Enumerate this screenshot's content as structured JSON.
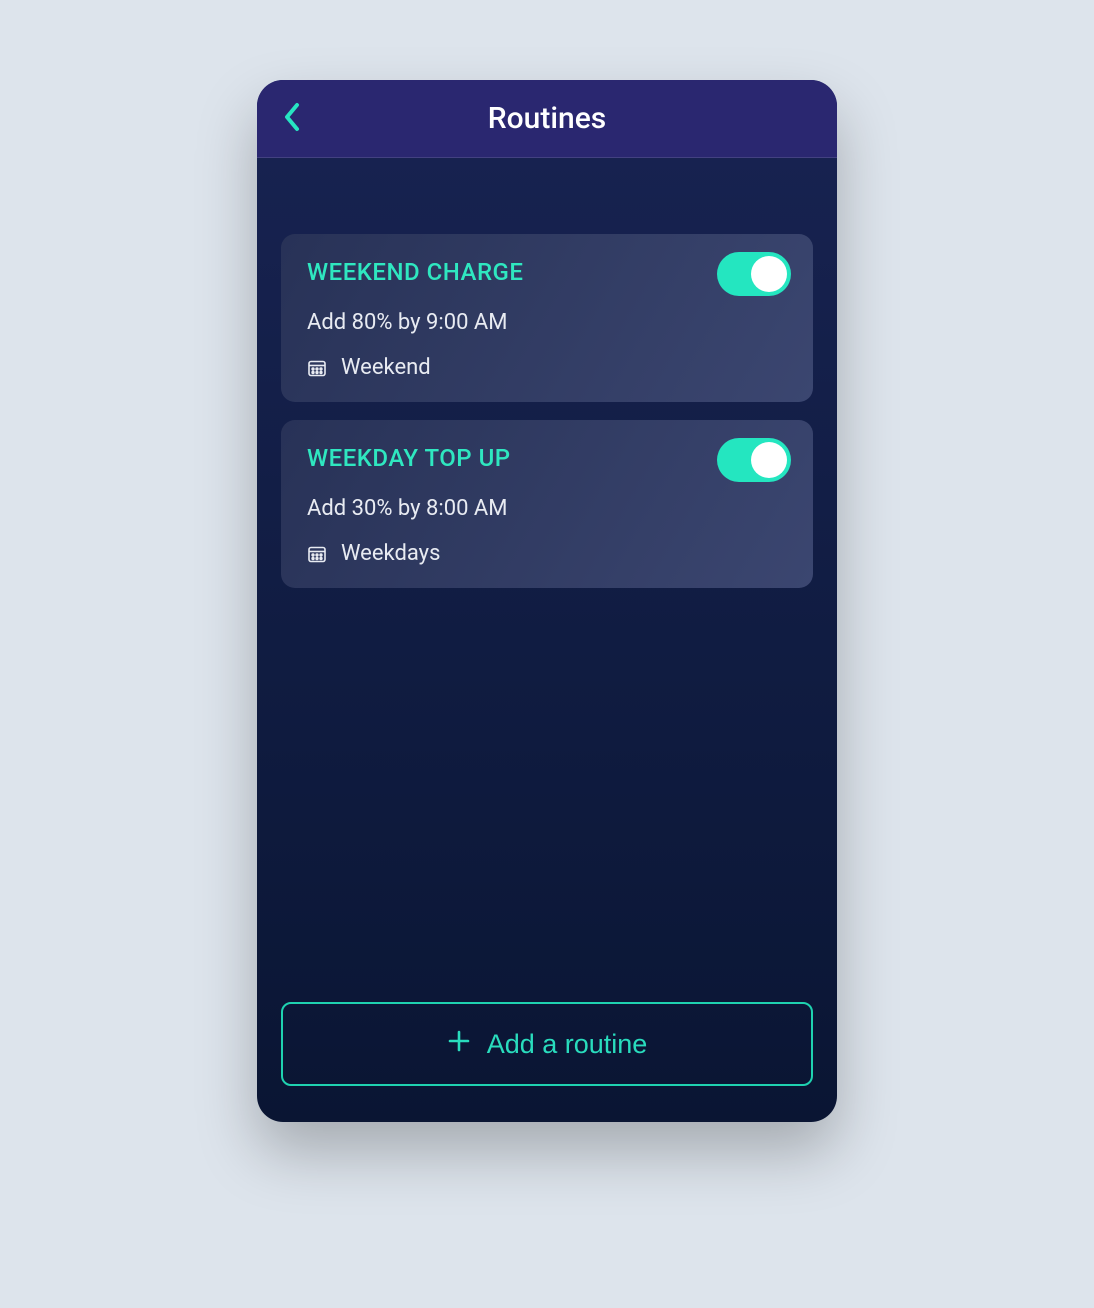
{
  "header": {
    "title": "Routines"
  },
  "routines": [
    {
      "title": "WEEKEND CHARGE",
      "description": "Add 80% by 9:00 AM",
      "schedule": "Weekend",
      "enabled": true
    },
    {
      "title": "WEEKDAY TOP UP",
      "description": "Add 30% by 8:00 AM",
      "schedule": "Weekdays",
      "enabled": true
    }
  ],
  "footer": {
    "add_label": "Add a routine"
  }
}
